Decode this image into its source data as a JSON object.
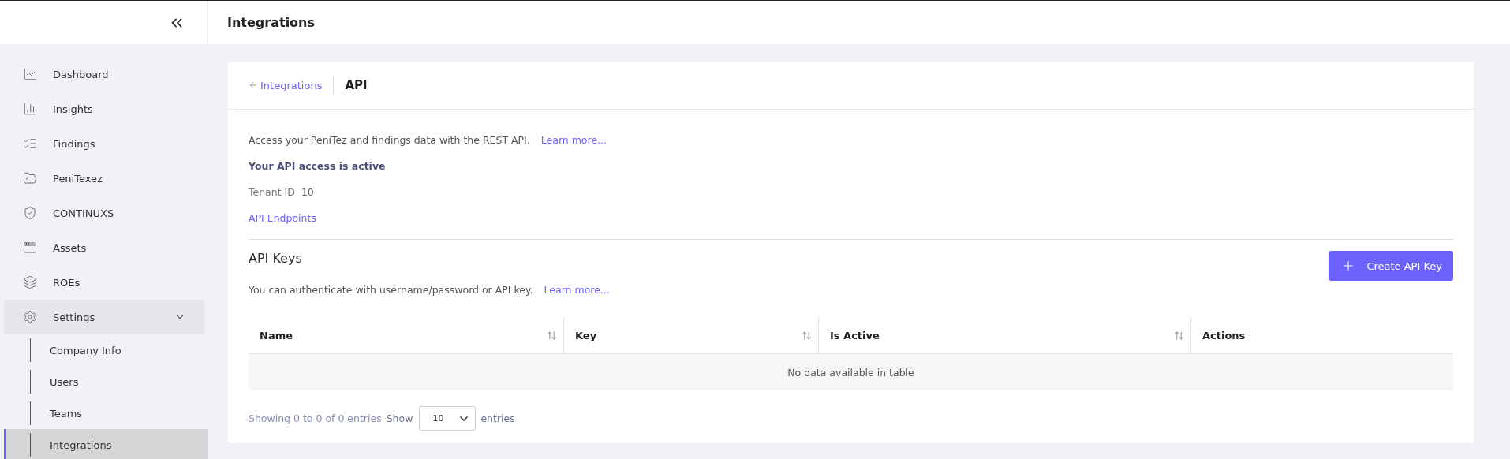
{
  "header": {
    "title": "Integrations"
  },
  "sidebar": {
    "items": [
      {
        "label": "Dashboard",
        "selected": false
      },
      {
        "label": "Insights",
        "selected": false
      },
      {
        "label": "Findings",
        "selected": false
      },
      {
        "label": "PeniTexez",
        "selected": false
      },
      {
        "label": "CONTINUXS",
        "selected": false
      },
      {
        "label": "Assets",
        "selected": false
      },
      {
        "label": "ROEs",
        "selected": false
      },
      {
        "label": "Settings",
        "selected": false,
        "expanded": true,
        "children": [
          {
            "label": "Company Info",
            "selected": false
          },
          {
            "label": "Users",
            "selected": false
          },
          {
            "label": "Teams",
            "selected": false
          },
          {
            "label": "Integrations",
            "selected": true
          }
        ]
      }
    ]
  },
  "card": {
    "back_link": "Integrations",
    "title": "API",
    "intro": "Access your PeniTez and findings data with the REST API.",
    "intro_link": "Learn more...",
    "status": "Your API access is active",
    "tenant_label": "Tenant ID",
    "tenant_value": "10",
    "endpoints_link": "API Endpoints",
    "keys_title": "API Keys",
    "keys_text": "You can authenticate with username/password or API key.",
    "keys_link": "Learn more...",
    "create_button": "Create API Key",
    "table": {
      "columns": [
        {
          "label": "Name",
          "sortable": true
        },
        {
          "label": "Key",
          "sortable": true
        },
        {
          "label": "Is Active",
          "sortable": true
        },
        {
          "label": "Actions",
          "sortable": false
        }
      ],
      "empty": "No data available in table"
    },
    "footer": {
      "info": "Showing 0 to 0 of 0 entries",
      "show": "Show",
      "page_size": "10",
      "entries": "entries"
    }
  }
}
